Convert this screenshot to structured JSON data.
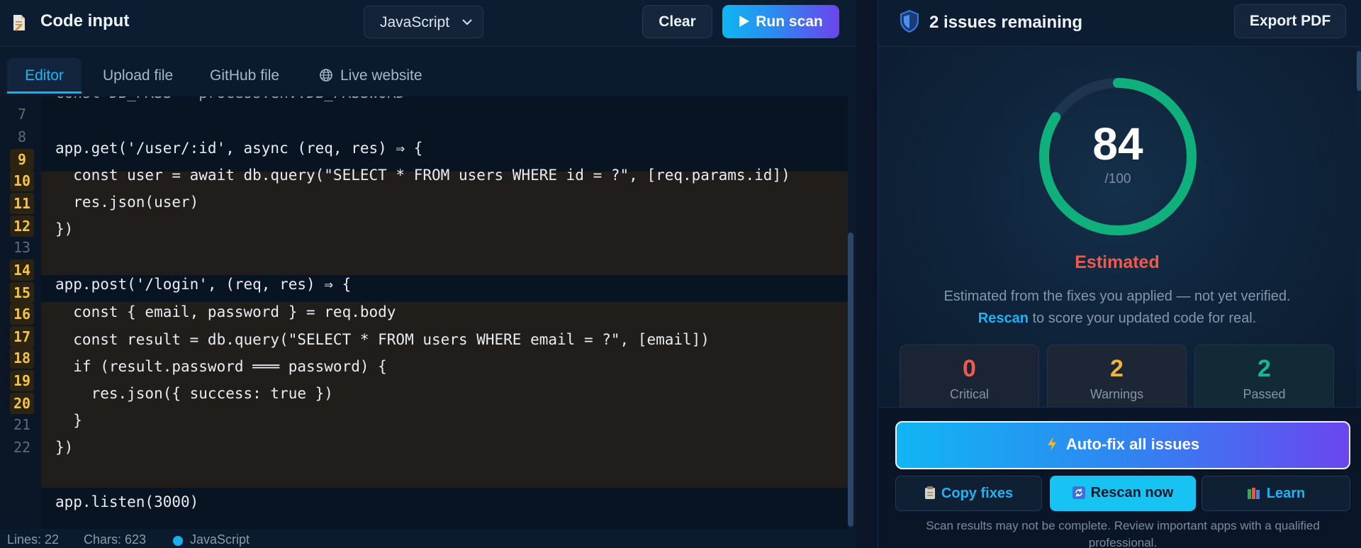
{
  "editor_panel": {
    "title": "Code input",
    "language_select": {
      "value": "JavaScript"
    },
    "clear_label": "Clear",
    "run_label": "Run scan",
    "tabs": [
      "Editor",
      "Upload file",
      "GitHub file",
      "Live website"
    ],
    "active_tab": "Editor",
    "line_numbers": [
      "7",
      "8",
      "9",
      "10",
      "11",
      "12",
      "13",
      "14",
      "15",
      "16",
      "17",
      "18",
      "19",
      "20",
      "21",
      "22"
    ],
    "flagged_lines": [
      "9",
      "10",
      "11",
      "12",
      "14",
      "15",
      "16",
      "17",
      "18",
      "19",
      "20"
    ],
    "code": {
      "l6": "const DB_PASS = process.env.DB_PASSWORD",
      "l9": "app.get('/user/:id', async (req, res) ⇒ {",
      "l10": "  const user = await db.query(\"SELECT * FROM users WHERE id = ?\", [req.params.id])",
      "l11": "  res.json(user)",
      "l12": "})",
      "l14": "app.post('/login', (req, res) ⇒ {",
      "l15": "  const { email, password } = req.body",
      "l16": "  const result = db.query(\"SELECT * FROM users WHERE email = ?\", [email])",
      "l17": "  if (result.password ═══ password) {",
      "l18": "    res.json({ success: true })",
      "l19": "  }",
      "l20": "})",
      "l22": "app.listen(3000)"
    },
    "status": {
      "lines": "Lines: 22",
      "chars": "Chars: 623",
      "language": "JavaScript"
    }
  },
  "results_panel": {
    "title": "2 issues remaining",
    "export_label": "Export PDF",
    "score": "84",
    "score_max": "/100",
    "score_fraction": 0.84,
    "estimated_label": "Estimated",
    "estimate_text_1": "Estimated from the fixes you applied — not yet verified.",
    "rescan_link": "Rescan",
    "estimate_text_2": " to score your updated code for real.",
    "stats": {
      "critical": {
        "value": "0",
        "label": "Critical",
        "color": "#ef5a4c"
      },
      "warnings": {
        "value": "2",
        "label": "Warnings",
        "color": "#f2b23e"
      },
      "passed": {
        "value": "2",
        "label": "Passed",
        "color": "#17b890"
      }
    },
    "autofix_label": "Auto-fix all issues",
    "copy_label": "Copy fixes",
    "rescan_label": "Rescan now",
    "learn_label": "Learn",
    "disclaimer": "Scan results may not be complete. Review important apps with a qualified professional."
  },
  "colors": {
    "accent": "#12b0f0",
    "gauge": "#10b07c",
    "warning_line": "#f2c542"
  },
  "icons": [
    "file-icon",
    "chevron-down-icon",
    "play-icon",
    "globe-icon",
    "shield-icon",
    "bolt-icon",
    "clipboard-icon",
    "refresh-icon",
    "books-icon"
  ]
}
